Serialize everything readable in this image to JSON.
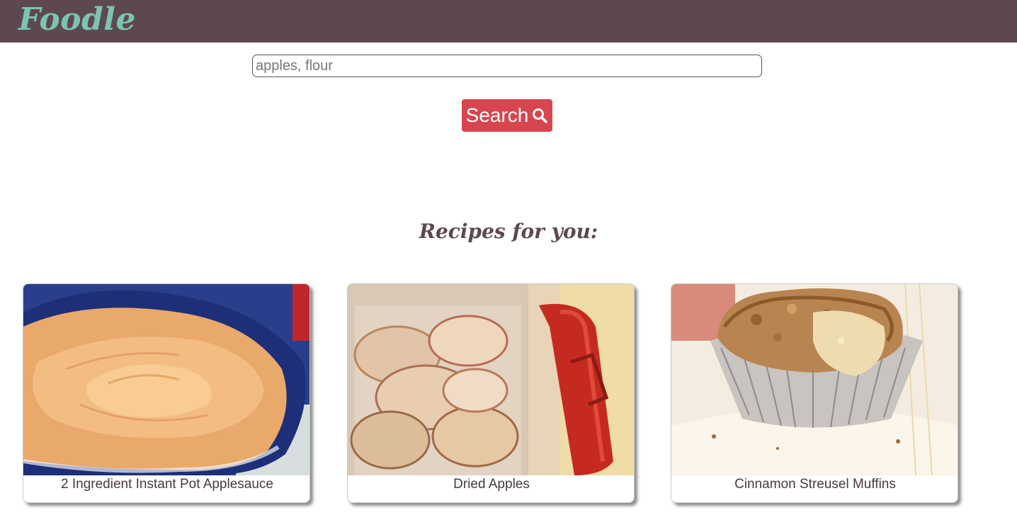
{
  "header": {
    "logo": "Foodle",
    "background_color": "#5e4850",
    "logo_color": "#7bc4b2"
  },
  "search": {
    "placeholder": "apples, flour",
    "button_label": "Search",
    "button_icon": "search-icon",
    "button_color": "#d9454e"
  },
  "recipes": {
    "title": "Recipes for you:",
    "items": [
      {
        "name": "2 Ingredient Instant Pot Applesauce",
        "image": "applesauce-photo"
      },
      {
        "name": "Dried Apples",
        "image": "dried-apples-photo"
      },
      {
        "name": "Cinnamon Streusel Muffins",
        "image": "muffin-photo"
      }
    ]
  }
}
